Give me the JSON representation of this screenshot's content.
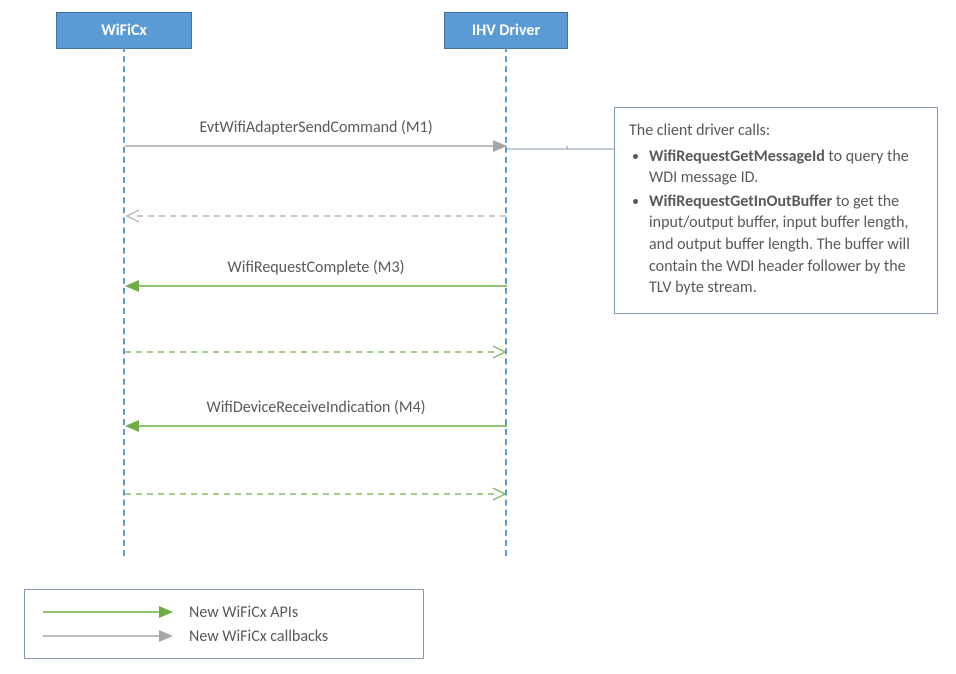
{
  "participants": {
    "left": "WiFiCx",
    "right": "IHV Driver"
  },
  "messages": {
    "m1": "EvtWifiAdapterSendCommand (M1)",
    "m3": "WifiRequestComplete (M3)",
    "m4": "WifiDeviceReceiveIndication (M4)"
  },
  "note": {
    "intro": "The client driver calls:",
    "b1_bold": "WifiRequestGetMessageId",
    "b1_rest": " to query the WDI message ID.",
    "b2_bold": "WifiRequestGetInOutBuffer",
    "b2_rest": " to get the input/output buffer, input buffer length, and output buffer length. The buffer will contain the WDI header follower by the TLV byte stream."
  },
  "legend": {
    "apis": "New WiFiCx APIs",
    "callbacks": "New WiFiCx callbacks"
  },
  "colors": {
    "green": "#70ad47",
    "gray": "#a6a6a6",
    "blue": "#5b9bd5",
    "border": "#8497b0"
  }
}
